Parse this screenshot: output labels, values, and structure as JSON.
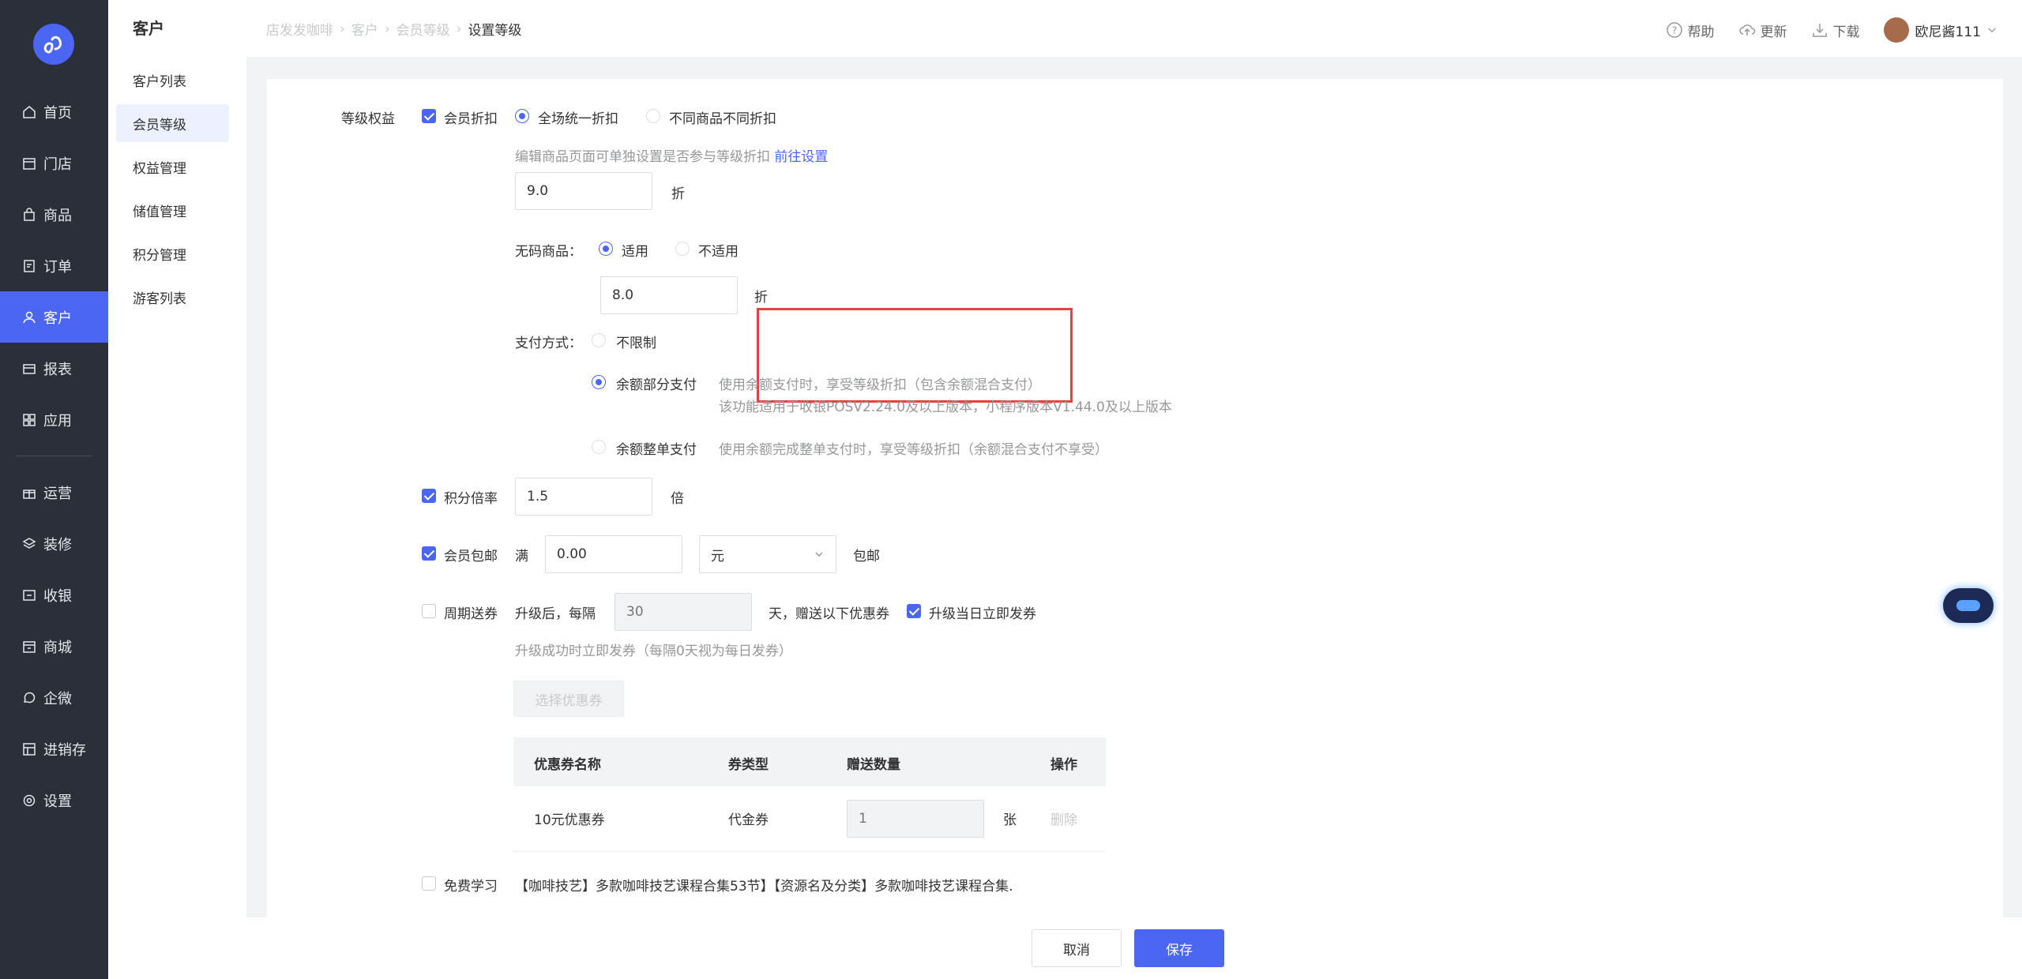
{
  "nav": {
    "items": [
      {
        "label": "首页",
        "icon": "home-icon"
      },
      {
        "label": "门店",
        "icon": "store-icon"
      },
      {
        "label": "商品",
        "icon": "bag-icon"
      },
      {
        "label": "订单",
        "icon": "order-icon"
      },
      {
        "label": "客户",
        "icon": "user-icon",
        "active": true
      },
      {
        "label": "报表",
        "icon": "report-icon"
      },
      {
        "label": "应用",
        "icon": "apps-icon"
      },
      {
        "label": "运营",
        "icon": "gift-icon"
      },
      {
        "label": "装修",
        "icon": "layers-icon"
      },
      {
        "label": "收银",
        "icon": "cashier-icon"
      },
      {
        "label": "商城",
        "icon": "mall-icon"
      },
      {
        "label": "企微",
        "icon": "chat-icon"
      },
      {
        "label": "进销存",
        "icon": "inventory-icon"
      },
      {
        "label": "设置",
        "icon": "settings-icon"
      }
    ]
  },
  "subnav": {
    "title": "客户",
    "items": [
      "客户列表",
      "会员等级",
      "权益管理",
      "储值管理",
      "积分管理",
      "游客列表"
    ],
    "active": "会员等级"
  },
  "breadcrumb": [
    "店发发咖啡",
    "客户",
    "会员等级",
    "设置等级"
  ],
  "topbar": {
    "help": "帮助",
    "update": "更新",
    "download": "下载",
    "user": "欧尼酱111"
  },
  "form": {
    "section_label": "等级权益",
    "discount": {
      "label": "会员折扣",
      "checked": true,
      "opt_unified": "全场统一折扣",
      "opt_diff": "不同商品不同折扣",
      "hint": "编辑商品页面可单独设置是否参与等级折扣",
      "hint_link": "前往设置",
      "value": "9.0",
      "unit": "折"
    },
    "nocode": {
      "label": "无码商品：",
      "opt_yes": "适用",
      "opt_no": "不适用",
      "value": "8.0",
      "unit": "折"
    },
    "payment": {
      "label": "支付方式：",
      "opt_unlimited": "不限制",
      "opt_partial": "余额部分支付",
      "partial_desc1": "使用余额支付时，享受等级折扣（包含余额混合支付）",
      "partial_desc2": "该功能适用于收银POSV2.24.0及以上版本，小程序版本V1.44.0及以上版本",
      "opt_full": "余额整单支付",
      "full_desc": "使用余额完成整单支付时，享受等级折扣（余额混合支付不享受）"
    },
    "points": {
      "label": "积分倍率",
      "checked": true,
      "value": "1.5",
      "unit": "倍"
    },
    "shipping": {
      "label": "会员包邮",
      "checked": true,
      "prefix": "满",
      "value": "0.00",
      "currency": "元",
      "suffix": "包邮"
    },
    "coupon": {
      "label": "周期送券",
      "checked": false,
      "prefix": "升级后，每隔",
      "placeholder": "30",
      "suffix": "天，赠送以下优惠券",
      "immediate_label": "升级当日立即发券",
      "immediate_checked": true,
      "hint": "升级成功时立即发券（每隔0天视为每日发券）",
      "select_button": "选择优惠券",
      "table": {
        "headers": [
          "优惠券名称",
          "券类型",
          "赠送数量",
          "操作"
        ],
        "rows": [
          {
            "name": "10元优惠券",
            "type": "代金券",
            "qty_placeholder": "1",
            "qty_unit": "张",
            "action": "删除"
          }
        ]
      }
    },
    "study": {
      "label": "免费学习",
      "checked": false,
      "text": "【咖啡技艺】多款咖啡技艺课程合集53节】【资源名及分类】多款咖啡技艺课程合集."
    }
  },
  "footer": {
    "cancel": "取消",
    "save": "保存"
  },
  "colors": {
    "primary": "#4b66f3",
    "nav_bg": "#2b2f3a",
    "highlight": "#e8403f"
  }
}
